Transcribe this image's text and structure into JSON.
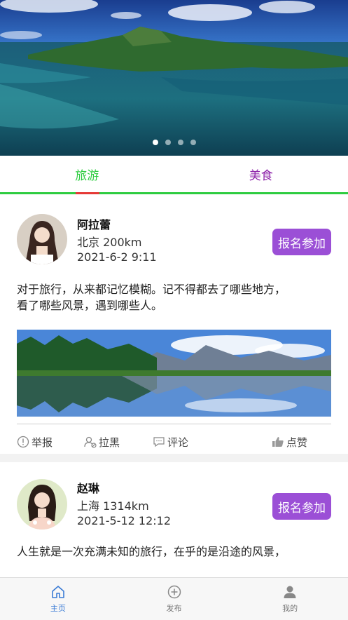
{
  "banner": {
    "slides": 4,
    "active_slide": 1
  },
  "tabs": [
    {
      "label": "旅游",
      "color": "#2ecc40",
      "active": true
    },
    {
      "label": "美食",
      "color": "#8e24aa",
      "active": false
    }
  ],
  "posts": [
    {
      "name": "阿拉蕾",
      "location": "北京 200km",
      "date": "2021-6-2 9:11",
      "join_label": "报名参加",
      "content_line1": "对于旅行，从来都记忆模糊。记不得都去了哪些地方，",
      "content_line2": "看了哪些风景，遇到哪些人。"
    },
    {
      "name": "赵琳",
      "location": "上海 1314km",
      "date": "2021-5-12 12:12",
      "join_label": "报名参加",
      "content_line1": "人生就是一次充满未知的旅行，在乎的是沿途的风景，"
    }
  ],
  "actions": {
    "report": "举报",
    "block": "拉黑",
    "comment": "评论",
    "like": "点赞"
  },
  "bottom_nav": [
    {
      "label": "主页",
      "icon": "home-icon",
      "active": true
    },
    {
      "label": "发布",
      "icon": "plus-circle-icon",
      "active": false
    },
    {
      "label": "我的",
      "icon": "user-icon",
      "active": false
    }
  ],
  "colors": {
    "accent_green": "#2ecc40",
    "accent_purple": "#9b4fd6",
    "nav_active": "#3a7bd5"
  }
}
